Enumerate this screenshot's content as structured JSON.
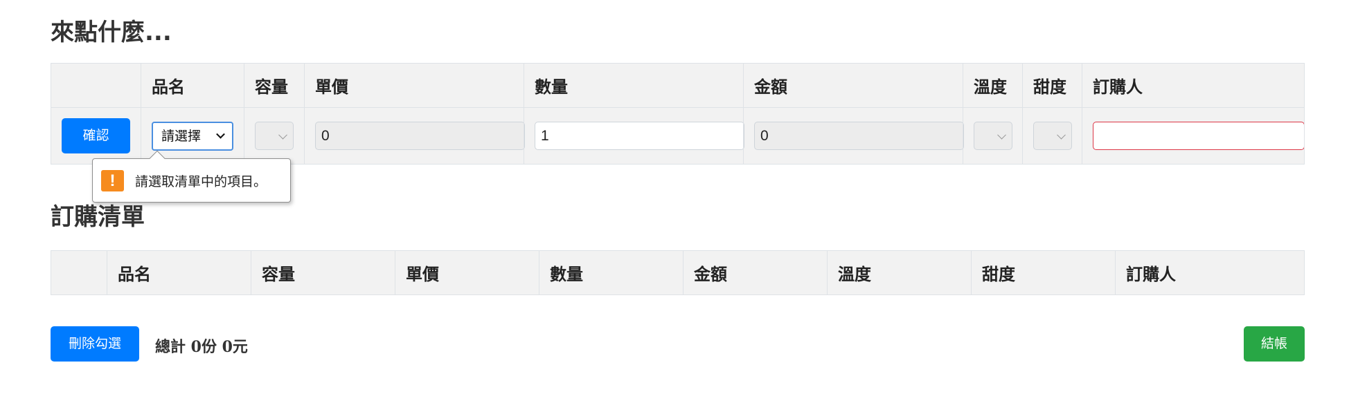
{
  "order_section": {
    "title": "來點什麼...",
    "headers": [
      "品名",
      "容量",
      "單價",
      "數量",
      "金額",
      "溫度",
      "甜度",
      "訂購人"
    ],
    "confirm_label": "確認",
    "product_select_value": "請選擇",
    "unit_price_value": "0",
    "quantity_value": "1",
    "amount_value": "0",
    "orderer_value": ""
  },
  "validation_tooltip": {
    "icon": "warning-icon",
    "icon_glyph": "!",
    "message": "請選取清單中的項目。",
    "icon_color": "#f68b1e"
  },
  "list_section": {
    "title": "訂購清單",
    "headers": [
      "品名",
      "容量",
      "單價",
      "數量",
      "金額",
      "溫度",
      "甜度",
      "訂購人"
    ]
  },
  "footer": {
    "delete_label": "刪除勾選",
    "total_text": "總計 0份 0元",
    "checkout_label": "結帳"
  },
  "colors": {
    "primary": "#007bff",
    "success": "#28a745",
    "invalid": "#dc3545"
  }
}
